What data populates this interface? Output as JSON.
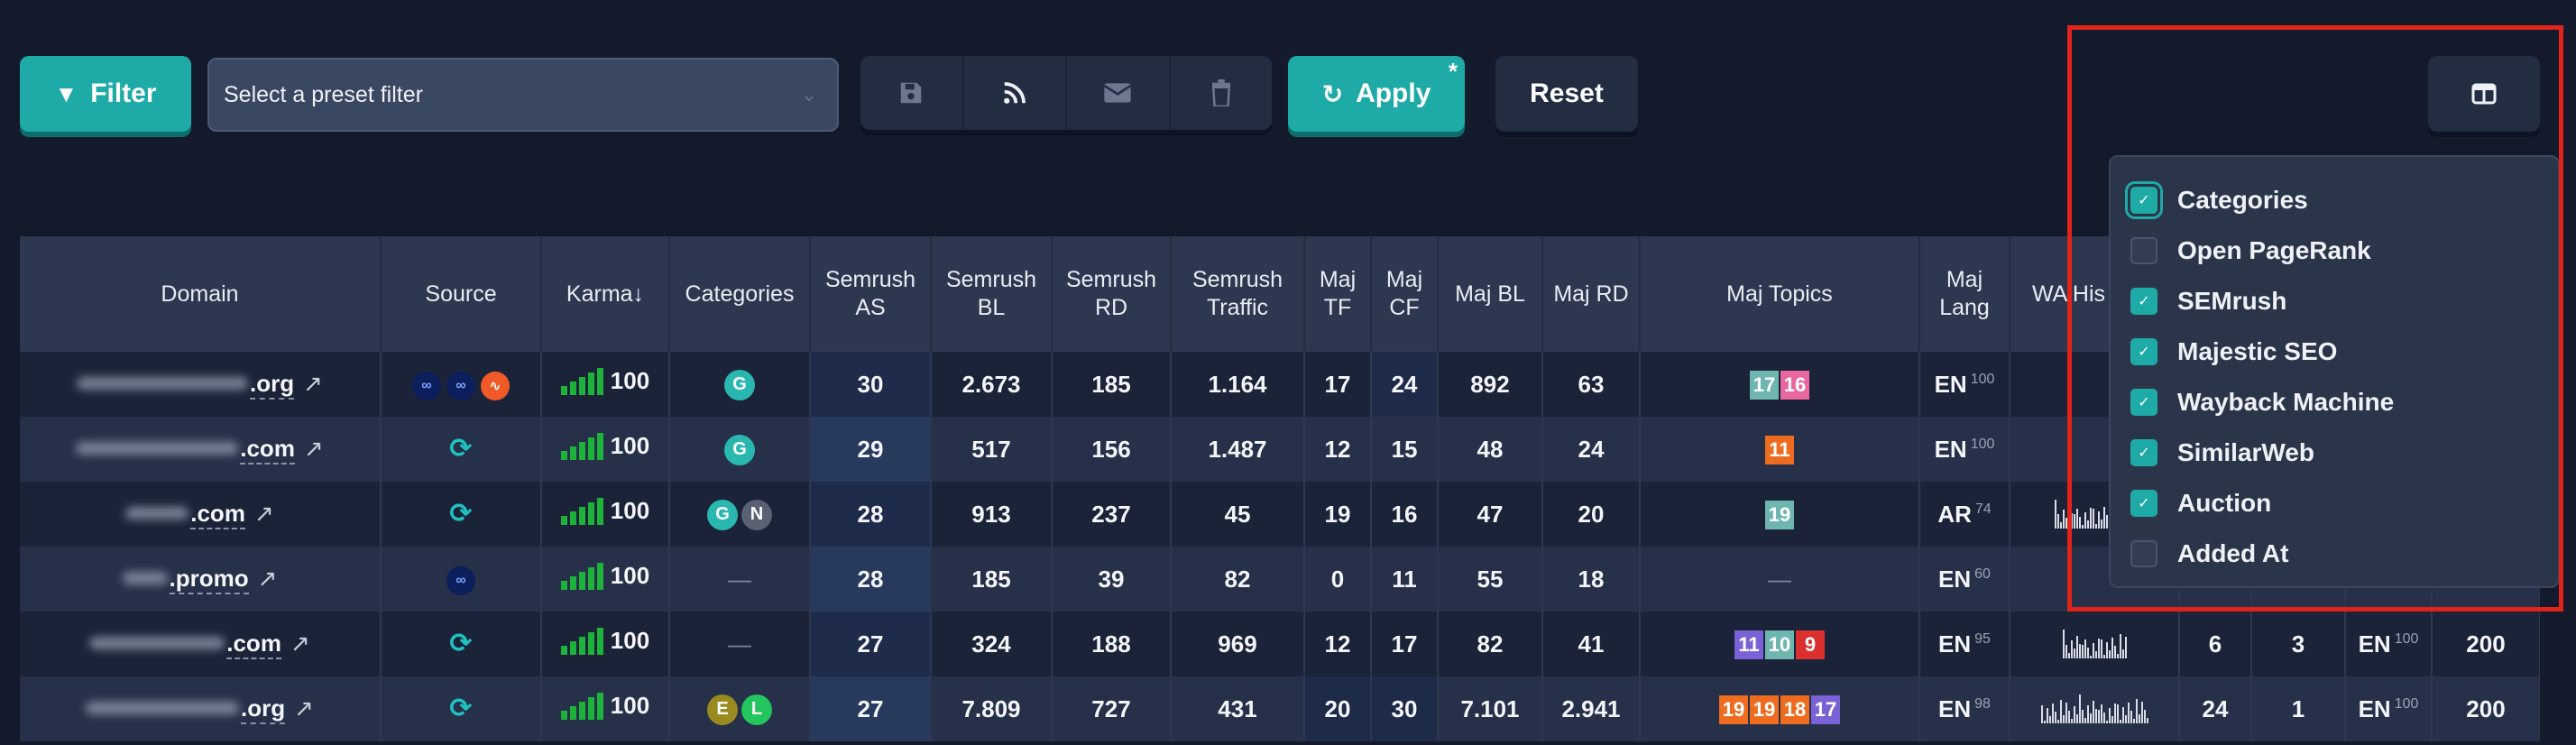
{
  "toolbar": {
    "filter_label": "Filter",
    "preset_placeholder": "Select a preset filter",
    "apply_label": "Apply",
    "apply_marker": "*",
    "reset_label": "Reset"
  },
  "table": {
    "headers": [
      "Domain",
      "Source",
      "Karma↓",
      "Categories",
      "Semrush AS",
      "Semrush BL",
      "Semrush RD",
      "Semrush Traffic",
      "Maj TF",
      "Maj CF",
      "Maj BL",
      "Maj RD",
      "Maj Topics",
      "Maj Lang",
      "WA His"
    ],
    "rows": [
      {
        "tld": ".org",
        "karma": "100",
        "cats": [
          "G"
        ],
        "as": "30",
        "bl": "2.673",
        "rd": "185",
        "traffic": "1.164",
        "tf": "17",
        "cf": "24",
        "majbl": "892",
        "majrd": "63",
        "topics": [
          "17",
          "16"
        ],
        "lang": "EN",
        "langscore": "100"
      },
      {
        "tld": ".com",
        "karma": "100",
        "cats": [
          "G"
        ],
        "as": "29",
        "bl": "517",
        "rd": "156",
        "traffic": "1.487",
        "tf": "12",
        "cf": "15",
        "majbl": "48",
        "majrd": "24",
        "topics": [
          "11"
        ],
        "lang": "EN",
        "langscore": "100"
      },
      {
        "tld": ".com",
        "karma": "100",
        "cats": [
          "G",
          "N"
        ],
        "as": "28",
        "bl": "913",
        "rd": "237",
        "traffic": "45",
        "tf": "19",
        "cf": "16",
        "majbl": "47",
        "majrd": "20",
        "topics": [
          "19"
        ],
        "lang": "AR",
        "langscore": "74"
      },
      {
        "tld": ".promo",
        "karma": "100",
        "cats": [],
        "as": "28",
        "bl": "185",
        "rd": "39",
        "traffic": "82",
        "tf": "0",
        "cf": "11",
        "majbl": "55",
        "majrd": "18",
        "topics": [],
        "lang": "EN",
        "langscore": "60"
      },
      {
        "tld": ".com",
        "karma": "100",
        "cats": [],
        "as": "27",
        "bl": "324",
        "rd": "188",
        "traffic": "969",
        "tf": "12",
        "cf": "17",
        "majbl": "82",
        "majrd": "41",
        "topics": [
          "11",
          "10",
          "9"
        ],
        "lang": "EN",
        "langscore": "95",
        "extra": [
          "6",
          "3",
          "EN",
          "100",
          "200"
        ]
      },
      {
        "tld": ".org",
        "karma": "100",
        "cats": [
          "E",
          "L"
        ],
        "as": "27",
        "bl": "7.809",
        "rd": "727",
        "traffic": "431",
        "tf": "20",
        "cf": "30",
        "majbl": "7.101",
        "majrd": "2.941",
        "topics": [
          "19",
          "19",
          "18",
          "17"
        ],
        "lang": "EN",
        "langscore": "98",
        "extra": [
          "24",
          "1",
          "EN",
          "100",
          "200"
        ]
      }
    ],
    "empty_marker": "—"
  },
  "column_menu": {
    "options": [
      {
        "label": "Categories",
        "checked": true
      },
      {
        "label": "Open PageRank",
        "checked": false
      },
      {
        "label": "SEMrush",
        "checked": true
      },
      {
        "label": "Majestic SEO",
        "checked": true
      },
      {
        "label": "Wayback Machine",
        "checked": true
      },
      {
        "label": "SimilarWeb",
        "checked": true
      },
      {
        "label": "Auction",
        "checked": true
      },
      {
        "label": "Added At",
        "checked": false
      }
    ]
  },
  "colors": {
    "accent": "#1eaaa6",
    "background": "#121a2c",
    "karma_green": "#1db23a",
    "highlight_box": "#e2231a"
  }
}
